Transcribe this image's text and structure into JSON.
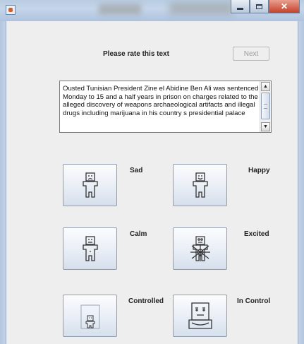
{
  "window": {
    "title": "",
    "controls": {
      "minimize": "–",
      "maximize": "□",
      "close": "✕"
    }
  },
  "header": {
    "prompt": "Please rate this text",
    "next_label": "Next"
  },
  "text_area": {
    "content": "Ousted Tunisian President Zine el Abidine Ben Ali was sentenced Monday to 15 and a half years in prison on charges related to the alleged discovery of weapons archaeological artifacts and illegal drugs including marijuana in his country s presidential palace",
    "scroll_up_icon": "▲",
    "scroll_down_icon": "▼"
  },
  "ratings": [
    {
      "label": "Sad",
      "icon": "sad-figure-icon"
    },
    {
      "label": "Happy",
      "icon": "happy-figure-icon"
    },
    {
      "label": "Calm",
      "icon": "calm-figure-icon"
    },
    {
      "label": "Excited",
      "icon": "excited-figure-icon"
    },
    {
      "label": "Controlled",
      "icon": "controlled-figure-icon"
    },
    {
      "label": "In Control",
      "icon": "in-control-figure-icon"
    }
  ]
}
